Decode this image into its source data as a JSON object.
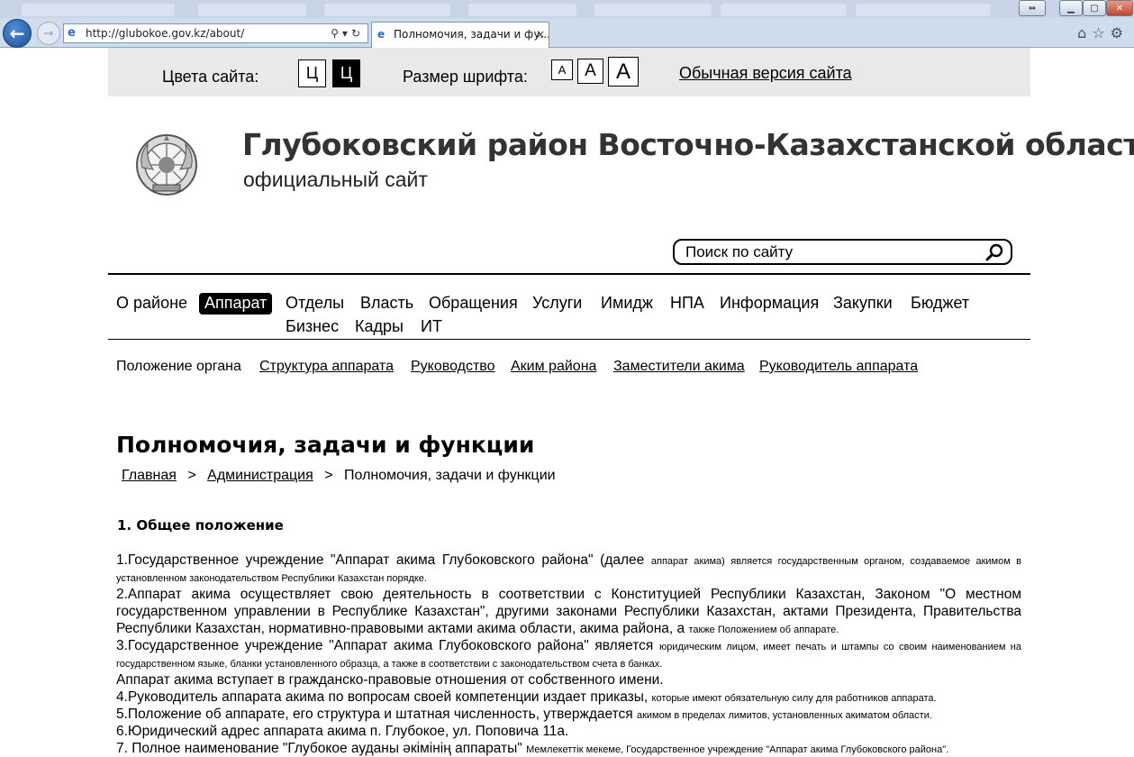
{
  "browser": {
    "url": "http://glubokoe.gov.kz/about/",
    "tab_title": "Полномочия, задачи и фу...",
    "tab_close": "×",
    "back_icon": "←",
    "forward_icon": "→"
  },
  "accessibility": {
    "colors_label": "Цвета сайта:",
    "color_white": "Ц",
    "color_black": "Ц",
    "font_size_label": "Размер шрифта:",
    "size_small": "A",
    "size_medium": "A",
    "size_large": "A",
    "normal_version": "Обычная версия сайта"
  },
  "header": {
    "title": "Глубоковский район Восточно-Казахстанской области",
    "subtitle": "официальный сайт",
    "search_placeholder": "Поиск по сайту"
  },
  "main_nav": [
    {
      "label": "О районе",
      "active": false
    },
    {
      "label": "Аппарат",
      "active": true
    },
    {
      "label": "Отделы",
      "active": false
    },
    {
      "label": "Власть",
      "active": false
    },
    {
      "label": "Обращения",
      "active": false
    },
    {
      "label": "Услуги",
      "active": false
    },
    {
      "label": "Имидж",
      "active": false
    },
    {
      "label": "НПА",
      "active": false
    },
    {
      "label": "Информация",
      "active": false
    },
    {
      "label": "Закупки",
      "active": false
    },
    {
      "label": "Бюджет",
      "active": false
    },
    {
      "label": "Бизнес",
      "active": false
    },
    {
      "label": "Кадры",
      "active": false
    },
    {
      "label": "ИТ",
      "active": false
    }
  ],
  "sub_nav": [
    {
      "label": "Положение органа",
      "link": false
    },
    {
      "label": "Структура аппарата",
      "link": true
    },
    {
      "label": "Руководство",
      "link": true
    },
    {
      "label": "Аким района",
      "link": true
    },
    {
      "label": "Заместители акима",
      "link": true
    },
    {
      "label": "Руководитель аппарата",
      "link": true
    }
  ],
  "content": {
    "page_title": "Полномочия, задачи и функции",
    "breadcrumb": {
      "home": "Главная",
      "sep": ">",
      "admin": "Администрация",
      "current": "Полномочия, задачи и функции"
    },
    "section_heading": "1. Общее положение",
    "paragraphs": [
      {
        "large": "1.Государственное учреждение \"Аппарат акима Глубоковского района\" (далее ",
        "small": "аппарат акима) является государственным органом, создаваемое акимом в установленном законодательством Республики Казахстан порядке."
      },
      {
        "large": "2.Аппарат акима осуществляет свою деятельность в соответствии с Конституцией Республики Казахстан, Законом \"О местном государственном управлении в Республике Казахстан\", другими законами Республики Казахстан, актами Президента, Правительства Республики Казахстан, нормативно-правовыми актами акима области, акима района, а ",
        "small": "также Положением об аппарате."
      },
      {
        "large": "3.Государственное учреждение \"Аппарат акима Глубоковского района\" является ",
        "small": "юридическим лицом, имеет печать и штампы со своим наименованием на государственном языке, бланки установленного образца, а также в соответствии с законодательством счета в банках."
      },
      {
        "large": "Аппарат акима вступает в гражданско-правовые отношения от собственного имени.",
        "small": ""
      },
      {
        "large": "4.Руководитель аппарата акима по вопросам своей компетенции издает приказы, ",
        "small": "которые имеют обязательную силу для работников аппарата."
      },
      {
        "large": "5.Положение об аппарате, его структура и штатная численность, утверждается ",
        "small": "акимом в пределах лимитов, установленных акиматом области."
      },
      {
        "large": "6.Юридический адрес аппарата акима п. Глубокое, ул. Поповича 11а.",
        "small": ""
      },
      {
        "large": "7. Полное наименование \"Глубокое ауданы әкімінің аппараты\" ",
        "small": "Мемлекеттік мекеме, Государственное учреждение \"Аппарат акима Глубоковского района\"."
      }
    ]
  },
  "icons": {
    "emblem": "kazakhstan-emblem-icon",
    "search": "search-icon",
    "ie": "ie-icon"
  }
}
